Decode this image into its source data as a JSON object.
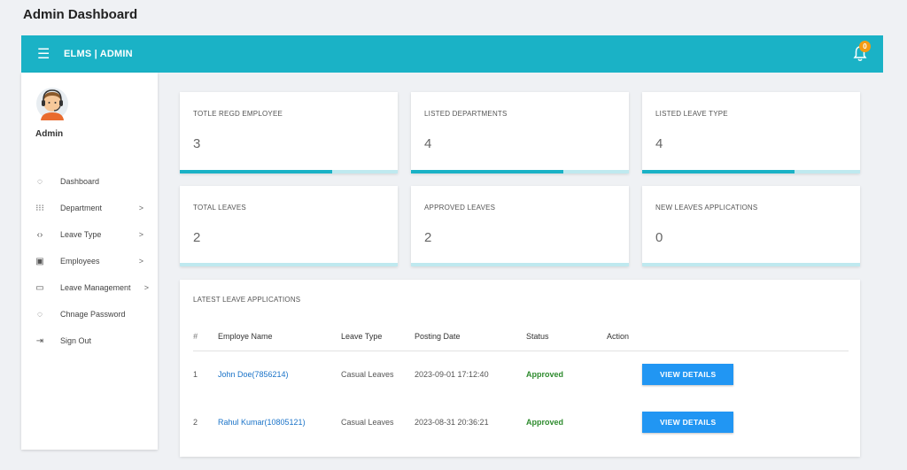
{
  "page": {
    "title": "Admin Dashboard"
  },
  "topbar": {
    "brand": "ELMS | ADMIN",
    "menu_icon": "hamburger-icon",
    "notification_icon": "bell-icon",
    "notification_count": "0"
  },
  "sidebar": {
    "user_name": "Admin",
    "items": [
      {
        "label": "Dashboard",
        "icon": "dashboard-icon",
        "has_submenu": false
      },
      {
        "label": "Department",
        "icon": "grid-icon",
        "has_submenu": true
      },
      {
        "label": "Leave Type",
        "icon": "code-icon",
        "has_submenu": true
      },
      {
        "label": "Employees",
        "icon": "account-box-icon",
        "has_submenu": true
      },
      {
        "label": "Leave Management",
        "icon": "desktop-icon",
        "has_submenu": true
      },
      {
        "label": "Chnage Password",
        "icon": "settings-icon",
        "has_submenu": false
      },
      {
        "label": "Sign Out",
        "icon": "sign-out-icon",
        "has_submenu": false
      }
    ],
    "chevron": ">"
  },
  "stats": [
    {
      "label": "TOTLE REGD EMPLOYEE",
      "value": "3",
      "progress": 0.7
    },
    {
      "label": "LISTED DEPARTMENTS",
      "value": "4",
      "progress": 0.7
    },
    {
      "label": "LISTED LEAVE TYPE",
      "value": "4",
      "progress": 0.7
    },
    {
      "label": "TOTAL LEAVES",
      "value": "2",
      "progress": 1.0
    },
    {
      "label": "APPROVED LEAVES",
      "value": "2",
      "progress": 1.0
    },
    {
      "label": "NEW LEAVES APPLICATIONS",
      "value": "0",
      "progress": 1.0
    }
  ],
  "latest": {
    "title": "LATEST LEAVE APPLICATIONS",
    "columns": [
      "#",
      "Employe Name",
      "Leave Type",
      "Posting Date",
      "Status",
      "Action"
    ],
    "rows": [
      {
        "num": "1",
        "name": "John Doe(7856214)",
        "leave_type": "Casual Leaves",
        "date": "2023-09-01 17:12:40",
        "status": "Approved",
        "action": "VIEW DETAILS"
      },
      {
        "num": "2",
        "name": "Rahul Kumar(10805121)",
        "leave_type": "Casual Leaves",
        "date": "2023-08-31 20:36:21",
        "status": "Approved",
        "action": "VIEW DETAILS"
      }
    ]
  },
  "colors": {
    "accent": "#1ab2c6",
    "button": "#2196f3",
    "approved": "#2e8b2e",
    "badge": "#f39c12"
  }
}
